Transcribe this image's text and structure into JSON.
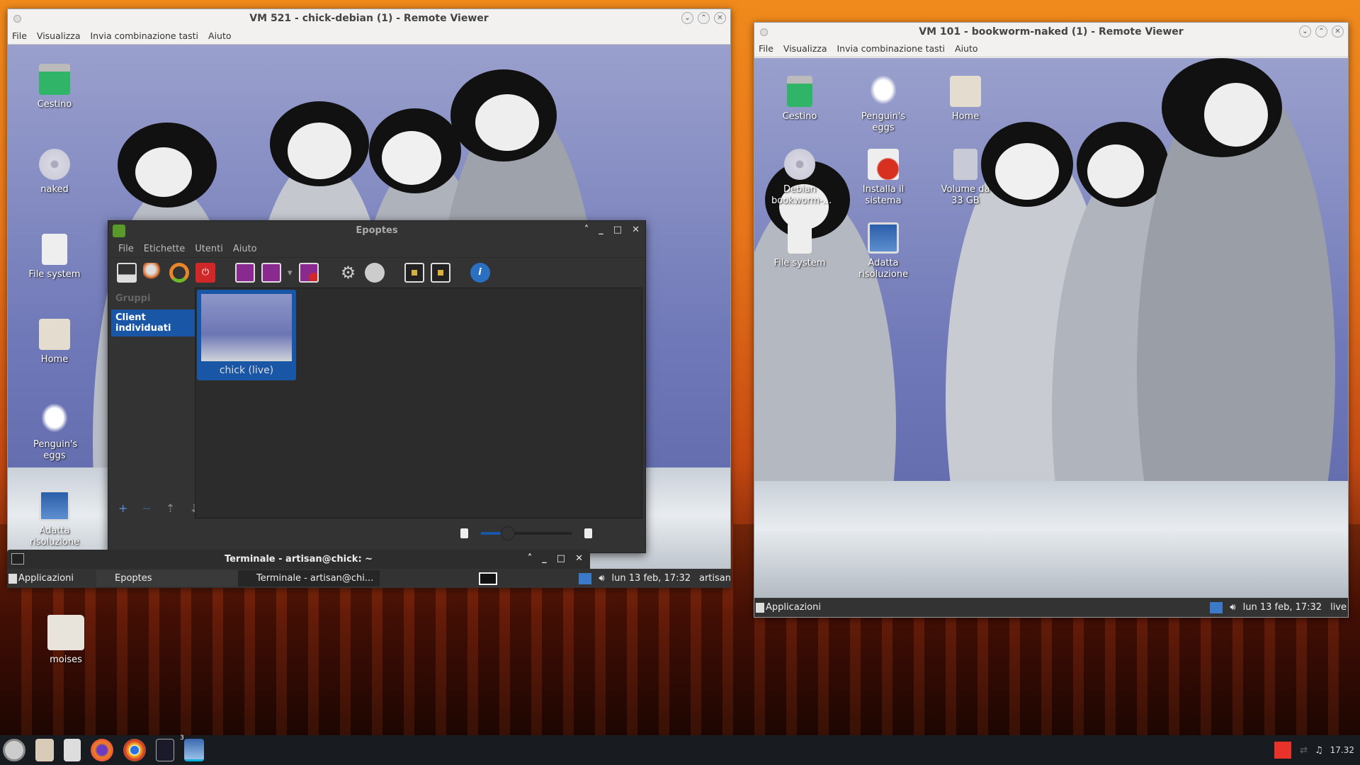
{
  "host": {
    "desktop_icons": [
      {
        "label": "moises",
        "icon": "folder-icon"
      }
    ],
    "taskbar": {
      "launchers": [
        "menu-icon",
        "file-manager-icon",
        "archive-icon",
        "firefox-icon",
        "chrome-icon",
        "terminal-icon",
        "remote-viewer-icon"
      ],
      "badge": "3",
      "clock": "17.32",
      "tray": [
        "anydesk-icon",
        "network-off-icon",
        "audio-icon"
      ]
    }
  },
  "vm_left": {
    "title": "VM 521 - chick-debian (1) - Remote Viewer",
    "menu": [
      "File",
      "Visualizza",
      "Invia combinazione tasti",
      "Aiuto"
    ],
    "desktop_icons": [
      "Cestino",
      "naked",
      "File system",
      "Home",
      "Penguin's eggs",
      "Adatta risoluzione"
    ],
    "taskbar": {
      "apps_label": "Applicazioni",
      "tasks": [
        "Epoptes",
        "Terminale - artisan@chi..."
      ],
      "clock": "lun 13 feb, 17:32",
      "user": "artisan"
    }
  },
  "terminal": {
    "title": "Terminale - artisan@chick: ~"
  },
  "epoptes": {
    "title": "Epoptes",
    "menu": [
      "File",
      "Etichette",
      "Utenti",
      "Aiuto"
    ],
    "toolbar": [
      "remote-assist-icon",
      "login-user-icon",
      "reboot-icon",
      "shutdown-icon",
      "broadcast-screen-icon",
      "broadcast-windowed-icon",
      "dropdown-icon",
      "stop-broadcast-icon",
      "execute-icon",
      "send-message-icon",
      "lock-screen-icon",
      "unlock-screen-icon",
      "info-icon"
    ],
    "groups_header": "Gruppi",
    "groups": [
      "Client individuati"
    ],
    "clients": [
      {
        "label": "chick (live)"
      }
    ],
    "zoom_level": 0.3,
    "accent": "#1a56a6"
  },
  "vm_right": {
    "title": "VM 101 - bookworm-naked (1) - Remote Viewer",
    "menu": [
      "File",
      "Visualizza",
      "Invia combinazione tasti",
      "Aiuto"
    ],
    "desktop_icons": [
      "Cestino",
      "Penguin's eggs",
      "Home",
      "Debian bookworm-...",
      "Installa il sistema",
      "Volume da 33 GB",
      "File system",
      "Adatta risoluzione"
    ],
    "taskbar": {
      "apps_label": "Applicazioni",
      "clock": "lun 13 feb, 17:32",
      "user": "live"
    }
  }
}
